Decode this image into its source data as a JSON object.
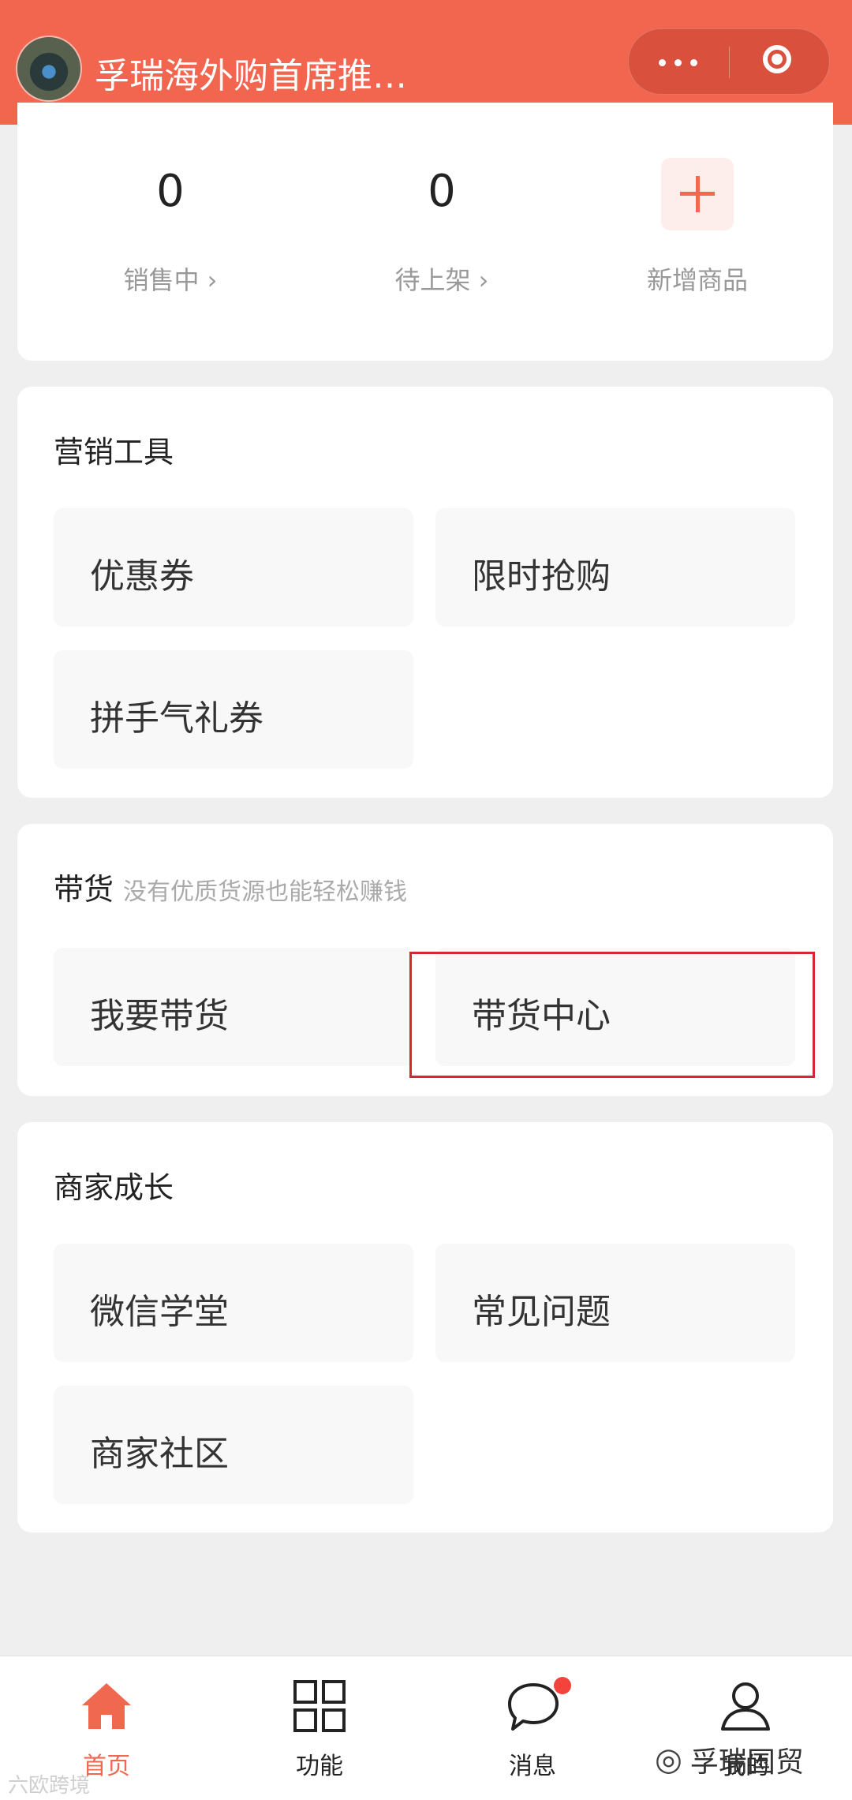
{
  "header": {
    "title": "孚瑞海外购首席推…",
    "more_icon": "more-dots-icon",
    "close_icon": "target-circle-icon",
    "bg_color": "#f26650"
  },
  "stats": [
    {
      "value": "0",
      "label": "销售中 ›"
    },
    {
      "value": "0",
      "label": "待上架 ›"
    }
  ],
  "add_product": {
    "label": "新增商品",
    "icon": "plus-icon"
  },
  "marketing": {
    "title": "营销工具",
    "items": [
      "优惠券",
      "限时抢购",
      "拼手气礼券"
    ]
  },
  "sales": {
    "title": "带货",
    "subtitle": "没有优质货源也能轻松赚钱",
    "items": [
      "我要带货",
      "带货中心"
    ]
  },
  "growth": {
    "title": "商家成长",
    "items": [
      "微信学堂",
      "常见问题",
      "商家社区"
    ]
  },
  "tabbar": {
    "items": [
      {
        "label": "首页",
        "icon": "home-icon",
        "active": true
      },
      {
        "label": "功能",
        "icon": "grid-icon",
        "active": false
      },
      {
        "label": "消息",
        "icon": "chat-bubble-icon",
        "active": false
      },
      {
        "label": "我的",
        "icon": "user-icon",
        "active": false
      }
    ],
    "accent": "#f06850"
  },
  "watermark": {
    "left": "六欧跨境",
    "right": "孚瑞国贸"
  }
}
